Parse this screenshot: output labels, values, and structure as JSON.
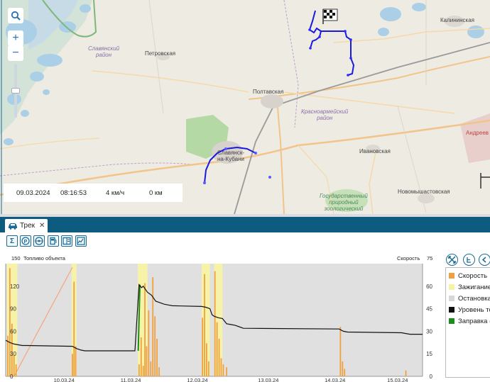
{
  "map": {
    "labels": {
      "slavyansky": "Славянский\nрайон",
      "petrovskaya": "Петровская",
      "poltavskaya": "Полтавская",
      "krasnoarmeysky": "Красноармейский\nрайон",
      "slavyansk": "Славянск-\nна-Кубани",
      "ivanovskaya": "Ивановская",
      "novomyshastovskaya": "Новомышастовская",
      "kalininskaya": "Калининская",
      "andreevskaya": "Андреев",
      "park": "Государственный\nприродный\nзоологический"
    },
    "zoom": {
      "search_icon": "search-icon",
      "plus": "+",
      "minus": "−"
    },
    "info": {
      "date": "09.03.2024",
      "time": "08:16:53",
      "speed": "4 км/ч",
      "distance": "0 км"
    }
  },
  "panel": {
    "tab_label": "Трек",
    "tab_close": "✕",
    "toolbar_icons": [
      "sum-icon",
      "parking-icon",
      "steering-wheel-icon",
      "fuel-icon",
      "columns-icon",
      "chart-icon"
    ]
  },
  "chart_data": {
    "type": "line",
    "left_axis_title": "Топливо объекта",
    "left_axis_top_label": "150",
    "right_axis_title": "Скорость",
    "right_axis_top_label": "75",
    "y_left_ticks": [
      "120",
      "90",
      "60",
      "30",
      "0"
    ],
    "y_right_ticks": [
      "60",
      "45",
      "30",
      "15",
      "0"
    ],
    "x_ticks": [
      "10.03.24",
      "11.03.24",
      "12.03.24",
      "13.03.24",
      "14.03.24",
      "15.03.24"
    ],
    "ylim_left": [
      0,
      150
    ],
    "ylim_right": [
      0,
      75
    ],
    "xlim": [
      0,
      100
    ],
    "fuel_series": {
      "name": "Уровень топлива",
      "color": "#111111",
      "x": [
        0,
        1,
        2,
        3,
        4,
        5,
        16,
        17,
        17.5,
        18,
        19,
        20,
        31,
        32,
        32.3,
        32.6,
        33,
        34,
        35,
        36,
        37,
        38,
        39,
        40,
        47,
        48,
        49,
        49.5,
        50,
        51,
        52,
        53,
        54,
        55,
        56,
        57,
        80,
        81,
        82,
        95,
        96,
        97,
        100
      ],
      "y": [
        48,
        45,
        43,
        42,
        41,
        41,
        40,
        37,
        36,
        35,
        34,
        34,
        34,
        122,
        120,
        118,
        120,
        112,
        108,
        100,
        98,
        96,
        95,
        94,
        93,
        92,
        90,
        82,
        80,
        78,
        77,
        70,
        69,
        68,
        66,
        64,
        63,
        60,
        59,
        58,
        57,
        56,
        56
      ]
    },
    "refuel_series": {
      "name": "Заправка (",
      "color": "#1e8c1e",
      "x": [
        31.8,
        32.2
      ],
      "y": [
        34,
        122
      ]
    },
    "trend_series": {
      "color": "#f4a57a",
      "x": [
        2,
        16
      ],
      "y": [
        0,
        145
      ]
    },
    "speed_bars": {
      "name": "Скорость",
      "color": "#f0a040",
      "x": [
        0.5,
        1,
        1.5,
        2,
        2.5,
        16,
        16.4,
        16.8,
        32,
        32.5,
        33,
        33.4,
        33.8,
        34.3,
        34.8,
        35.3,
        35.8,
        36.3,
        36.8,
        47.2,
        47.7,
        48.2,
        48.7,
        50.2,
        50.7,
        51.2,
        51.7,
        52.2,
        53,
        80.3,
        80.8,
        81.3,
        96
      ],
      "y": [
        27,
        72,
        35,
        14,
        8,
        15,
        63,
        20,
        8,
        26,
        7,
        62,
        20,
        44,
        10,
        66,
        40,
        25,
        6,
        39,
        68,
        22,
        10,
        70,
        36,
        25,
        12,
        8,
        6,
        33,
        10,
        5,
        4
      ]
    },
    "ignition_bands": {
      "name": "Зажигание",
      "color": "#f6f3a8",
      "ranges": [
        [
          0.3,
          2.8
        ],
        [
          15.8,
          17
        ],
        [
          31.7,
          34
        ],
        [
          47,
          49
        ],
        [
          50,
          52
        ]
      ]
    },
    "stop_color": "#e0e0e0",
    "legend": [
      {
        "label": "Скорость",
        "color": "#f0a040"
      },
      {
        "label": "Зажигание",
        "color": "#f6f3a8"
      },
      {
        "label": "Остановка",
        "color": "#d8d8d8"
      },
      {
        "label": "Уровень то",
        "color": "#111111"
      },
      {
        "label": "Заправка (",
        "color": "#1e8c1e"
      }
    ],
    "grid": false,
    "legend_position": "right"
  },
  "side_tools": [
    "expand-icon",
    "e-icon",
    "chevron-left-icon"
  ]
}
